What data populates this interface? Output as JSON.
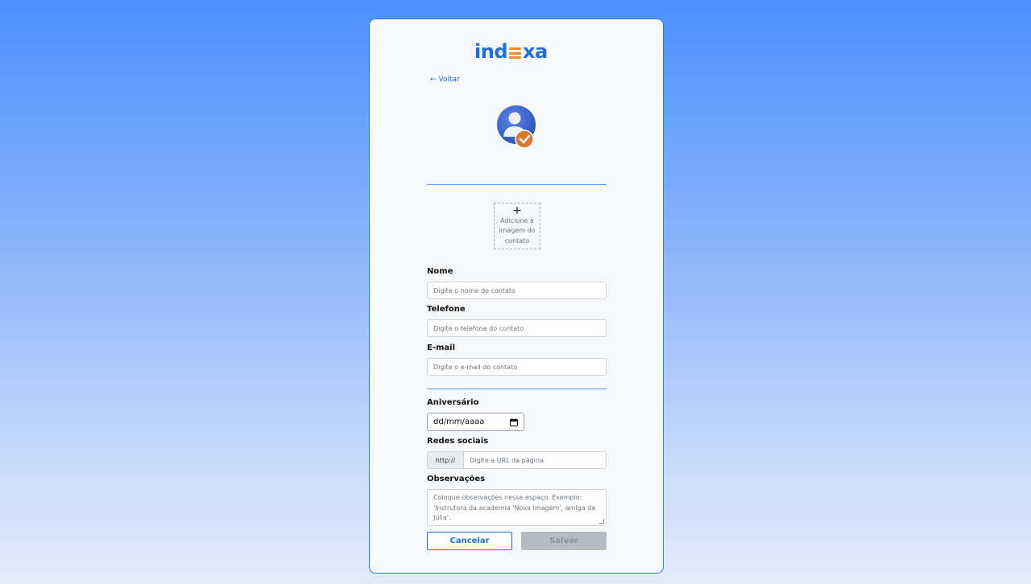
{
  "logo": {
    "text_before": "ind",
    "text_after": "xa",
    "colors": {
      "primary": "#1f6fe0",
      "accent": "#f08a2a"
    }
  },
  "back_link": {
    "arrow": "←",
    "label": "Voltar"
  },
  "avatar": {
    "icon": "user-verified-icon"
  },
  "upload": {
    "plus": "+",
    "label": "Adicione a imagem do contato"
  },
  "form": {
    "name": {
      "label": "Nome",
      "placeholder": "Digite o nome do contato"
    },
    "phone": {
      "label": "Telefone",
      "placeholder": "Digite o telefone do contato"
    },
    "email": {
      "label": "E-mail",
      "placeholder": "Digite o e-mail do contato"
    },
    "birthday": {
      "label": "Aniversário",
      "value": "dd/mm/aaaa",
      "icon": "calendar-icon"
    },
    "social": {
      "label": "Redes sociais",
      "prefix": "http://",
      "placeholder": "Digite a URL da página"
    },
    "notes": {
      "label": "Observações",
      "placeholder": "Coloque observações nesse espaço. Exemplo: 'Instrutora da academia 'Nova Imagem', amiga da Júlia'."
    }
  },
  "buttons": {
    "cancel": "Cancelar",
    "save": "Salvar"
  }
}
